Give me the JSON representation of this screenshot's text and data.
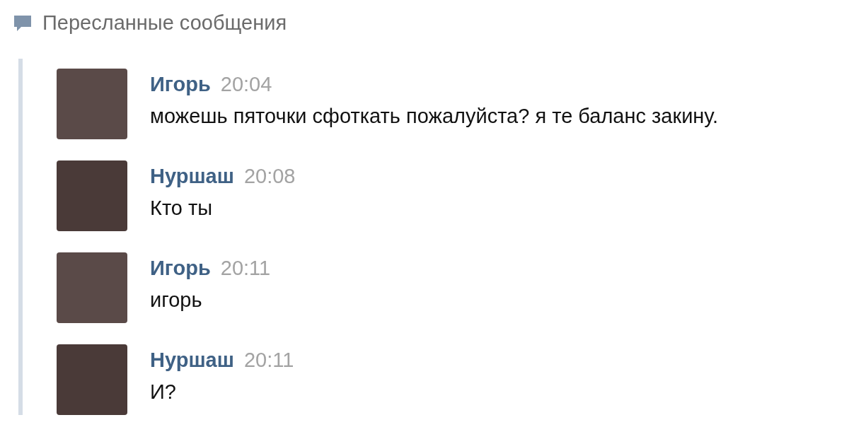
{
  "header": {
    "title": "Пересланные сообщения"
  },
  "messages": [
    {
      "author": "Игорь",
      "time": "20:04",
      "text": "можешь пяточки сфоткать пожалуйста? я те баланс закину."
    },
    {
      "author": "Нуршаш",
      "time": "20:08",
      "text": "Кто ты"
    },
    {
      "author": "Игорь",
      "time": "20:11",
      "text": "игорь"
    },
    {
      "author": "Нуршаш",
      "time": "20:11",
      "text": "И?"
    }
  ]
}
